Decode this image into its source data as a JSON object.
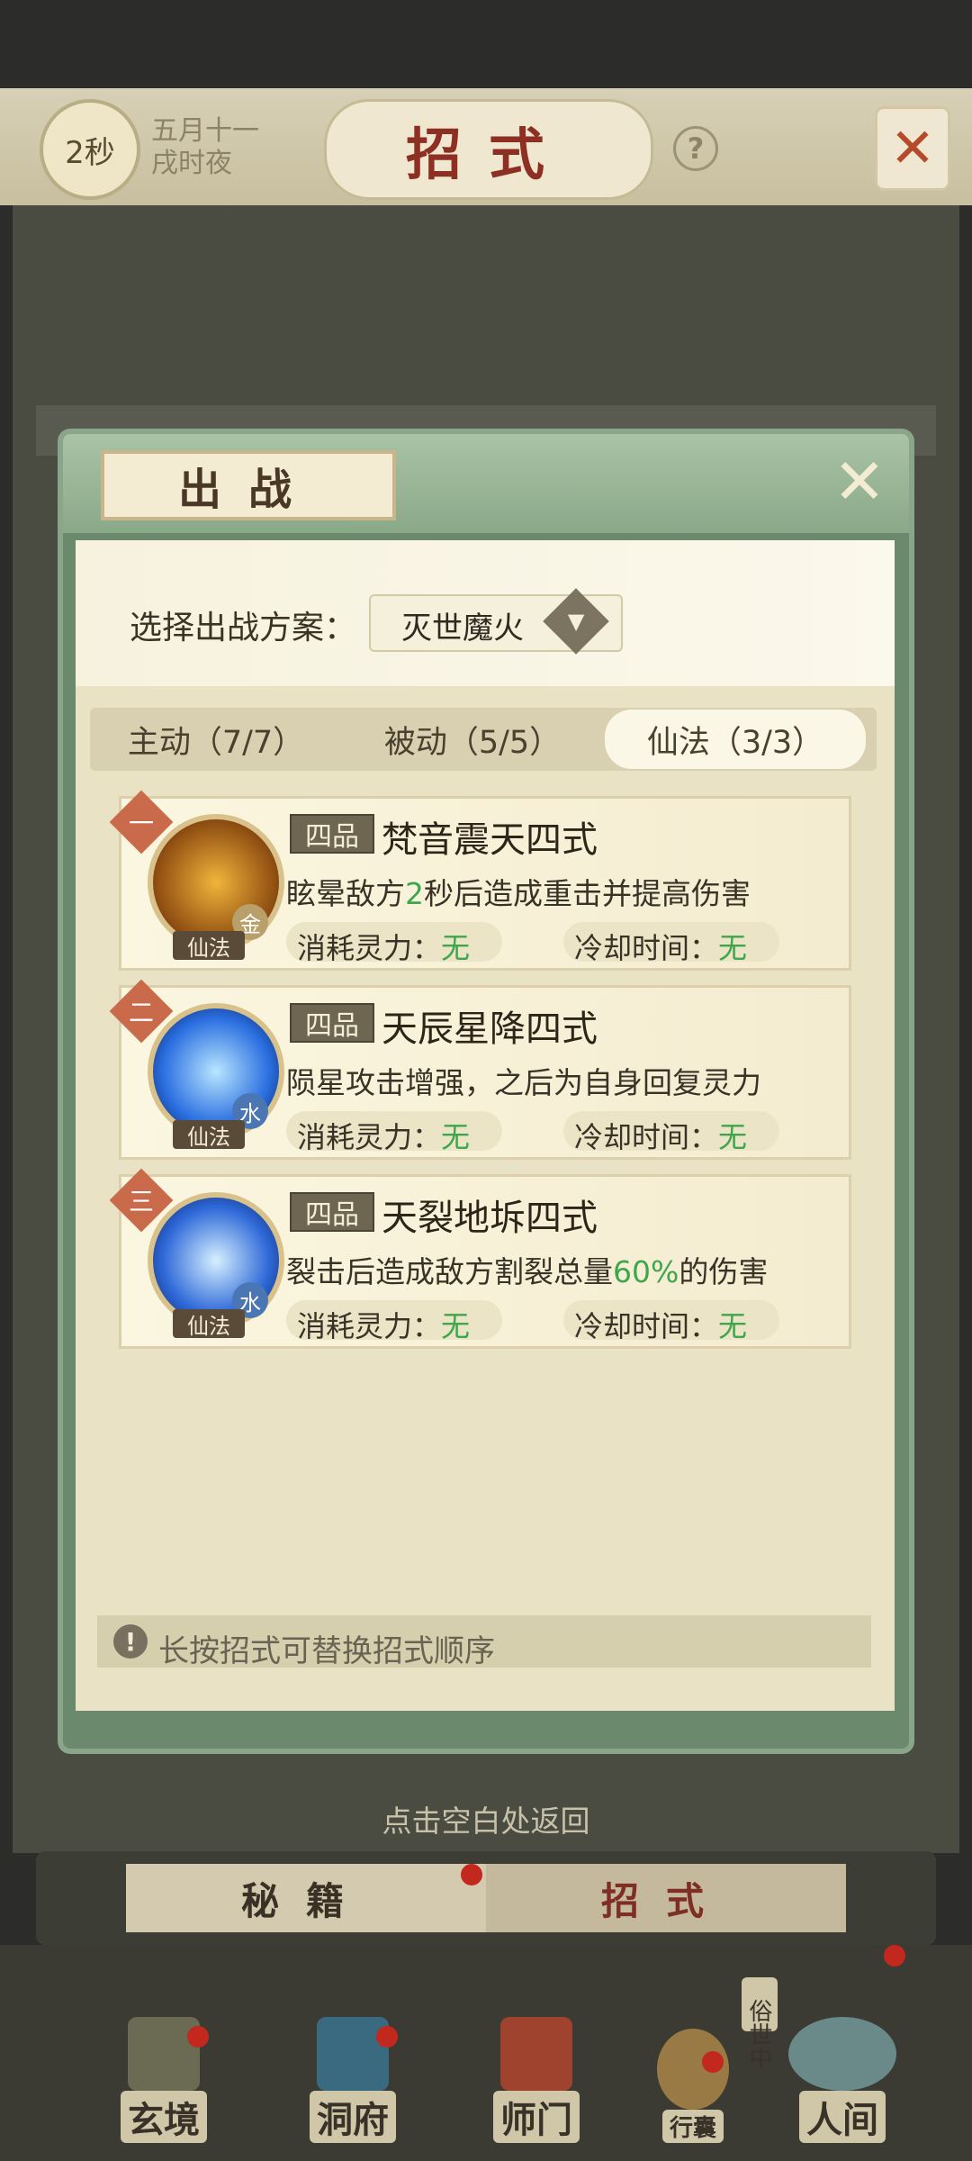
{
  "header": {
    "timer": "2秒",
    "date_line1": "五月十一",
    "date_line2": "戌时夜",
    "title": "招式"
  },
  "modal": {
    "title": "出战",
    "plan_label": "选择出战方案：",
    "plan_value": "灭世魔火",
    "tabs": [
      {
        "label": "主动（7/7）"
      },
      {
        "label": "被动（5/5）"
      },
      {
        "label": "仙法（3/3）"
      }
    ],
    "skills": [
      {
        "index": "一",
        "element": "金",
        "type": "仙法",
        "grade": "四品",
        "name": "梵音震天四式",
        "desc_pre": "眩晕敌方",
        "desc_hl": "2",
        "desc_post": "秒后造成重击并提高伤害",
        "cost_label": "消耗灵力：",
        "cost_value": "无",
        "cd_label": "冷却时间：",
        "cd_value": "无"
      },
      {
        "index": "二",
        "element": "水",
        "type": "仙法",
        "grade": "四品",
        "name": "天辰星降四式",
        "desc_pre": "陨星攻击增强，之后为自身回复灵力",
        "desc_hl": "",
        "desc_post": "",
        "cost_label": "消耗灵力：",
        "cost_value": "无",
        "cd_label": "冷却时间：",
        "cd_value": "无"
      },
      {
        "index": "三",
        "element": "水",
        "type": "仙法",
        "grade": "四品",
        "name": "天裂地坼四式",
        "desc_pre": "裂击后造成敌方割裂总量",
        "desc_hl": "60%",
        "desc_post": "的伤害",
        "cost_label": "消耗灵力：",
        "cost_value": "无",
        "cd_label": "冷却时间：",
        "cd_value": "无"
      }
    ],
    "tip": "长按招式可替换招式顺序"
  },
  "return_hint": "点击空白处返回",
  "bottom_tabs": {
    "left": "秘籍",
    "right": "招式"
  },
  "nav": {
    "items": [
      "玄境",
      "洞府",
      "师门",
      "行囊",
      "人间"
    ],
    "vertical_label": "俗世中"
  },
  "colors": {
    "accent_green": "#3ea64b",
    "title_red": "#8d2f22",
    "notify_red": "#c2281e"
  }
}
